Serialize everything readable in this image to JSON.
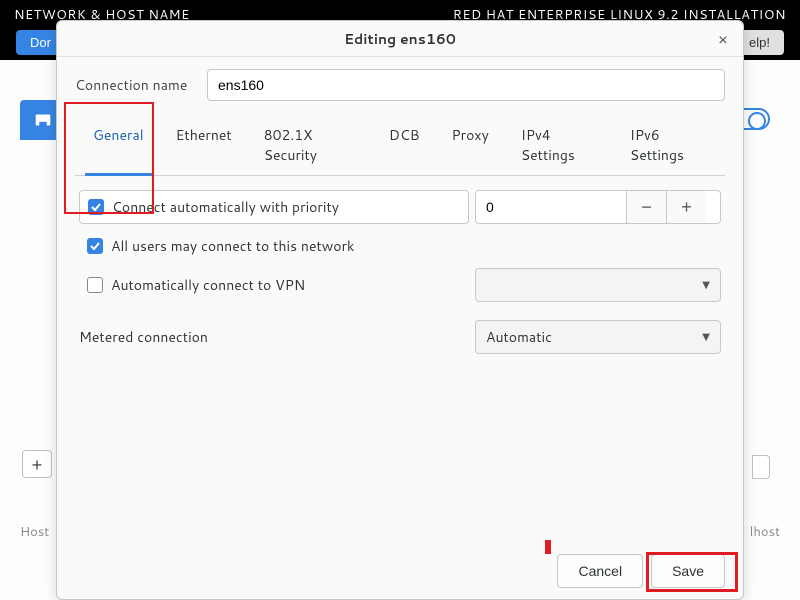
{
  "background": {
    "title_left": "NETWORK & HOST NAME",
    "title_right": "RED HAT ENTERPRISE LINUX 9.2 INSTALLATION",
    "done_btn": "Dor",
    "help_btn": "elp!",
    "plus_btn": "+",
    "host_label": "Host",
    "host_right": "lhost"
  },
  "dialog": {
    "title": "Editing ens160",
    "close": "×",
    "conn_name_label": "Connection name",
    "conn_name_value": "ens160",
    "tabs": {
      "general": "General",
      "ethernet": "Ethernet",
      "security": "802.1X Security",
      "dcb": "DCB",
      "proxy": "Proxy",
      "ipv4": "IPv4 Settings",
      "ipv6": "IPv6 Settings"
    },
    "general": {
      "auto_connect_label": "Connect automatically with priority",
      "priority_value": "0",
      "all_users_label": "All users may connect to this network",
      "auto_vpn_label": "Automatically connect to VPN",
      "vpn_select_value": "",
      "metered_label": "Metered connection",
      "metered_value": "Automatic"
    },
    "footer": {
      "cancel": "Cancel",
      "save": "Save"
    }
  }
}
